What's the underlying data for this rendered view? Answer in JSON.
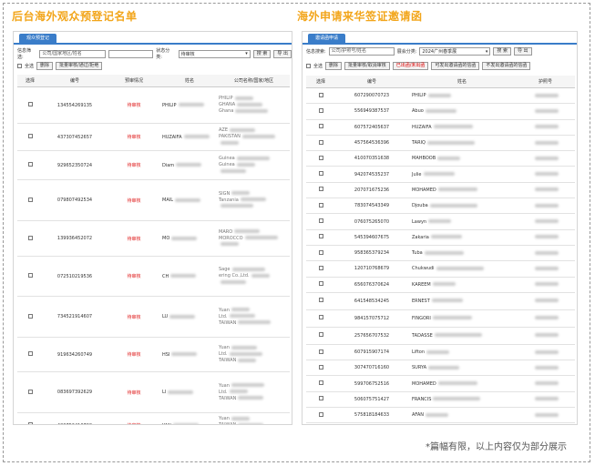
{
  "left_panel": {
    "heading": "后台海外观众预登记名单",
    "tab": "观众预登记",
    "search_label": "信息筛选:",
    "search_placeholder": "公司/国家地区/姓名",
    "status_label": "状态分类:",
    "status_value": "待审核",
    "search_button": "搜 索",
    "export_button": "导 出",
    "select_all": "全选",
    "delete_button": "删除",
    "batch_button": "批量审核/通过/拒绝",
    "columns": [
      "选择",
      "编号",
      "预审情况",
      "姓名",
      "公司名称/国家/地区"
    ],
    "rows": [
      {
        "id": "134554269135",
        "status": "待审核",
        "name": "PHILIP",
        "addr": [
          "PHILIP",
          "GHANA",
          "Ghana"
        ]
      },
      {
        "id": "437307452657",
        "status": "待审核",
        "name": "HUZAIFA",
        "addr": [
          "AZE",
          "PAKISTAN",
          ""
        ]
      },
      {
        "id": "929652350724",
        "status": "待审核",
        "name": "Diam",
        "addr": [
          "Guinea",
          "Guinea",
          ""
        ]
      },
      {
        "id": "079807492534",
        "status": "待审核",
        "name": "MAIL",
        "addr": [
          "SIGN",
          "Tanzania",
          ""
        ]
      },
      {
        "id": "139936452072",
        "status": "待审核",
        "name": "MO",
        "addr": [
          "MARO",
          "MOROCCO",
          ""
        ]
      },
      {
        "id": "072510219536",
        "status": "待审核",
        "name": "CH",
        "addr": [
          "Sage",
          "ering Co.,Ltd.",
          ""
        ]
      },
      {
        "id": "734521914607",
        "status": "待审核",
        "name": "LU",
        "addr": [
          "Yuan",
          "Ltd.",
          "TAIWAN"
        ]
      },
      {
        "id": "919634260749",
        "status": "待审核",
        "name": "HSI",
        "addr": [
          "Yuan",
          "Ltd.",
          "TAIWAN"
        ]
      },
      {
        "id": "083697392629",
        "status": "待审核",
        "name": "LI",
        "addr": [
          "Yuan",
          "Ltd.",
          "TAIWAN"
        ]
      },
      {
        "id": "420752410790",
        "status": "待审核",
        "name": "YAN",
        "addr": [
          "Yuan",
          "TAIWAN",
          ""
        ]
      }
    ]
  },
  "right_panel": {
    "heading": "海外申请来华签证邀请函",
    "tab": "邀请函申请",
    "search_label": "信息搜索:",
    "search_placeholder": "公司/护照号/姓名",
    "exhibit_label": "展会分类:",
    "exhibit_value": "2024广州春季展",
    "search_button": "搜 索",
    "export_button": "导 出",
    "select_all": "全选",
    "delete_button": "删除",
    "batch_buttons": [
      "批量审核/取消审核",
      "已出函/未出函",
      "可发出邀请函的信函",
      "不发出邀请函的信函"
    ],
    "columns": [
      "选择",
      "编号",
      "姓名",
      "护照号"
    ],
    "rows": [
      {
        "id": "607290070723",
        "name": "PHILIP"
      },
      {
        "id": "556949387537",
        "name": "Abuo"
      },
      {
        "id": "607572405637",
        "name": "HUZAIFA"
      },
      {
        "id": "457564536396",
        "name": "TARIQ"
      },
      {
        "id": "410070351638",
        "name": "MAHBOOB"
      },
      {
        "id": "942074535237",
        "name": "Julie"
      },
      {
        "id": "207071675236",
        "name": "MOHAMED"
      },
      {
        "id": "783074543349",
        "name": "Djouba"
      },
      {
        "id": "076075265070",
        "name": "Lawyn"
      },
      {
        "id": "545394607675",
        "name": "Zakaria"
      },
      {
        "id": "958365379234",
        "name": "Tuba"
      },
      {
        "id": "120710768679",
        "name": "Chukwudi"
      },
      {
        "id": "656076370624",
        "name": "KAREEM"
      },
      {
        "id": "641548534245",
        "name": "ERNEST"
      },
      {
        "id": "984157075712",
        "name": "FINGORI"
      },
      {
        "id": "257656707532",
        "name": "TADASSE"
      },
      {
        "id": "607915907174",
        "name": "Lifton"
      },
      {
        "id": "307470716160",
        "name": "SURYA"
      },
      {
        "id": "599706752516",
        "name": "MOHAMED"
      },
      {
        "id": "506075751427",
        "name": "FRANCIS"
      },
      {
        "id": "575818184633",
        "name": "AFAN"
      },
      {
        "id": "650735367628",
        "name": "AKASH"
      }
    ]
  },
  "footnote": "*篇幅有限，以上内容仅为部分展示",
  "colors": {
    "accent": "#3a7dc9",
    "heading": "#f2a51a",
    "status": "#e02020"
  }
}
